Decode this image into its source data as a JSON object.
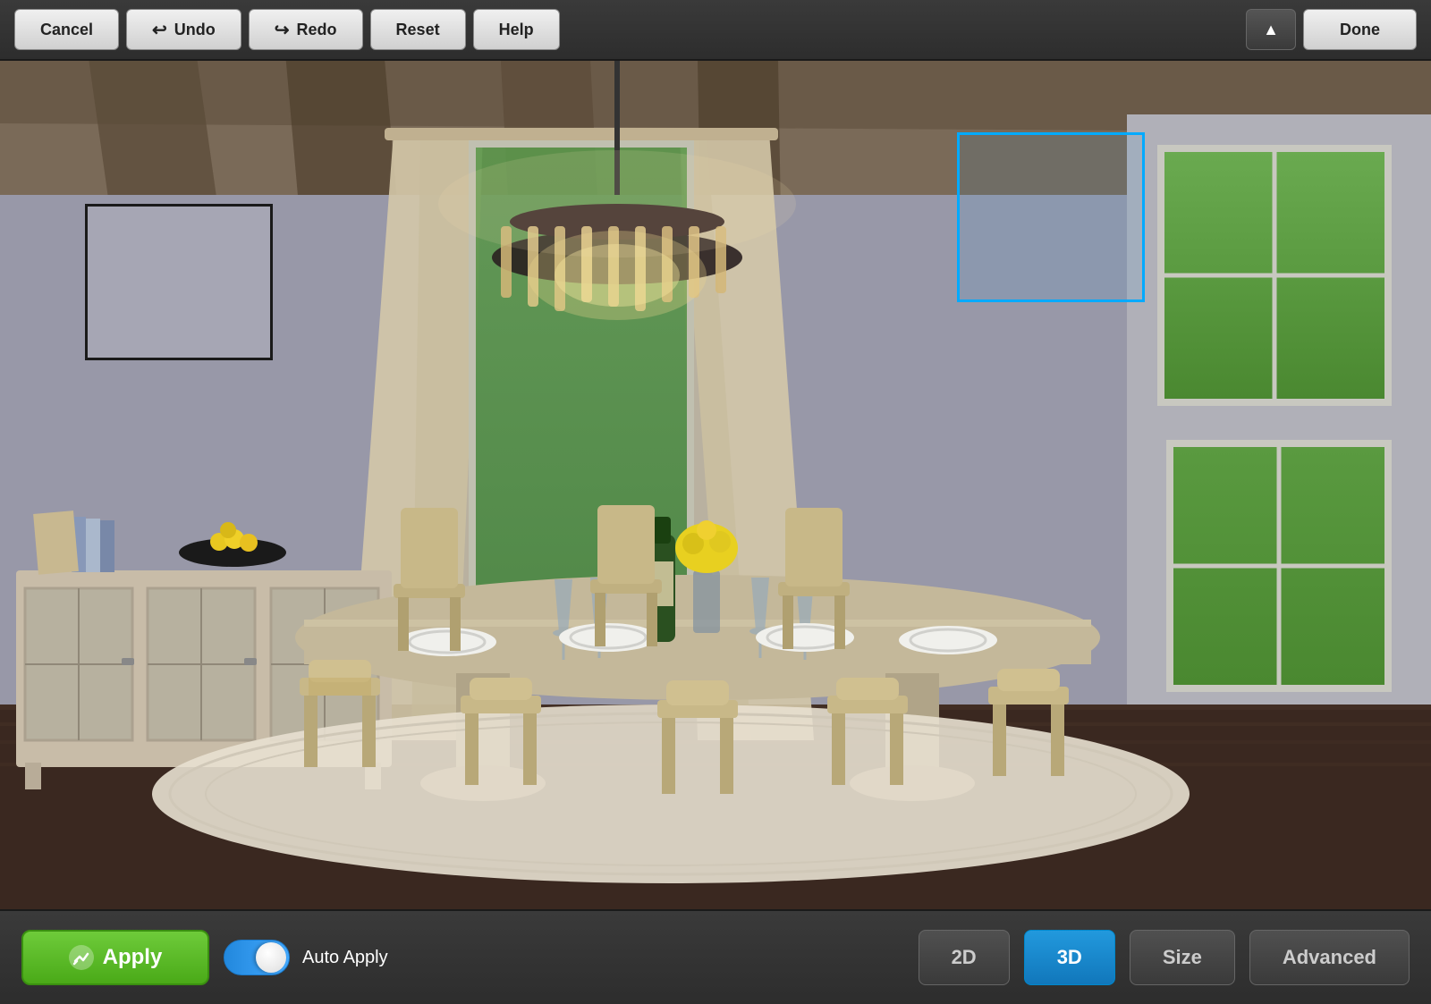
{
  "toolbar": {
    "cancel_label": "Cancel",
    "undo_label": "Undo",
    "redo_label": "Redo",
    "reset_label": "Reset",
    "help_label": "Help",
    "done_label": "Done",
    "collapse_icon": "▲"
  },
  "scene": {
    "selection_rect_visible": true,
    "frame_rect_visible": true
  },
  "bottom_bar": {
    "apply_label": "Apply",
    "apply_icon": "✏",
    "auto_apply_label": "Auto Apply",
    "btn_2d_label": "2D",
    "btn_3d_label": "3D",
    "btn_size_label": "Size",
    "btn_advanced_label": "Advanced",
    "active_view": "3D"
  }
}
